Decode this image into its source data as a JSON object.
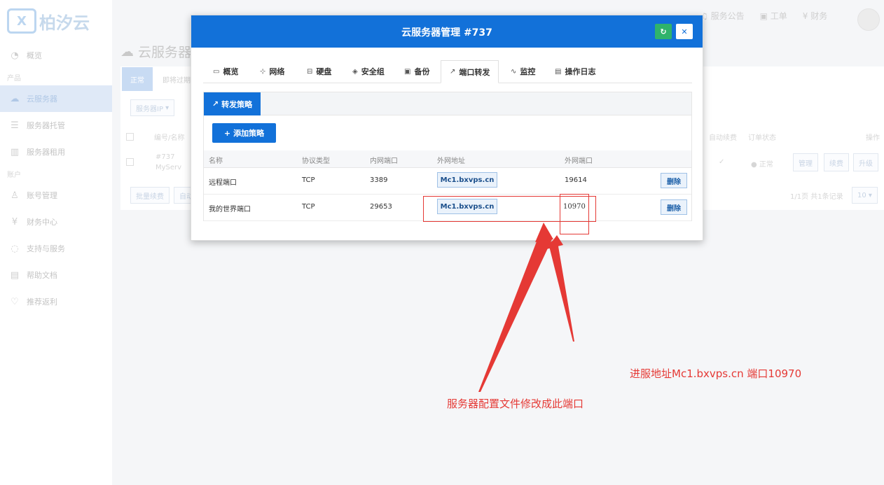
{
  "brand": {
    "logo_mark": "X",
    "name": "柏汐云"
  },
  "sidebar": {
    "groups": {
      "products": "产品",
      "account": "账户"
    },
    "items": [
      {
        "label": "概览",
        "icon": "dashboard-icon"
      },
      {
        "label": "云服务器",
        "icon": "cloud-icon",
        "active": true
      },
      {
        "label": "服务器托管",
        "icon": "server-icon"
      },
      {
        "label": "服务器租用",
        "icon": "rack-icon"
      },
      {
        "label": "账号管理",
        "icon": "user-icon"
      },
      {
        "label": "财务中心",
        "icon": "yen-icon"
      },
      {
        "label": "支持与服务",
        "icon": "chat-icon"
      },
      {
        "label": "帮助文档",
        "icon": "doc-icon"
      },
      {
        "label": "推荐返利",
        "icon": "heart-icon"
      }
    ]
  },
  "topbar": {
    "announcements": "服务公告",
    "tickets": "工单",
    "finance": "财务"
  },
  "page": {
    "title": "云服务器",
    "tab_active": "正常",
    "tab_expiring": "即将过期",
    "filter": "服务器IP",
    "col_id_name": "编号/名称",
    "col_auto_renew": "自动续费",
    "col_order_status": "订单状态",
    "col_action": "操作",
    "row_id": "#737",
    "row_name": "MyServ",
    "row_status": "正常",
    "btn_manage": "管理",
    "btn_renew": "续费",
    "btn_upgrade": "升级",
    "btn_batch_renew": "批量续费",
    "btn_auto": "自动",
    "pagination": "1/1页 共1条记录",
    "page_size": "10"
  },
  "modal": {
    "title": "云服务器管理 #737",
    "tabs": [
      {
        "label": "概览",
        "icon": "monitor-icon"
      },
      {
        "label": "网络",
        "icon": "network-icon"
      },
      {
        "label": "硬盘",
        "icon": "disk-icon"
      },
      {
        "label": "安全组",
        "icon": "shield-icon"
      },
      {
        "label": "备份",
        "icon": "save-icon"
      },
      {
        "label": "端口转发",
        "icon": "external-link-icon",
        "active": true
      },
      {
        "label": "监控",
        "icon": "pulse-icon"
      },
      {
        "label": "操作日志",
        "icon": "file-icon"
      }
    ],
    "subtab": "转发策略",
    "add_button": "添加策略",
    "columns": {
      "name": "名称",
      "protocol": "协议类型",
      "internal_port": "内网端口",
      "external_address": "外网地址",
      "external_port": "外网端口"
    },
    "rows": [
      {
        "name": "远程端口",
        "protocol": "TCP",
        "internal_port": "3389",
        "external_address": "Mc1.bxvps.cn",
        "external_port": "19614",
        "action": "删除"
      },
      {
        "name": "我的世界端口",
        "protocol": "TCP",
        "internal_port": "29653",
        "external_address": "Mc1.bxvps.cn",
        "external_port": "10970",
        "action": "删除"
      }
    ]
  },
  "annotations": {
    "left_note": "服务器配置文件修改成此端口",
    "right_note": "进服地址Mc1.bxvps.cn  端口10970",
    "color": "#e53935"
  }
}
